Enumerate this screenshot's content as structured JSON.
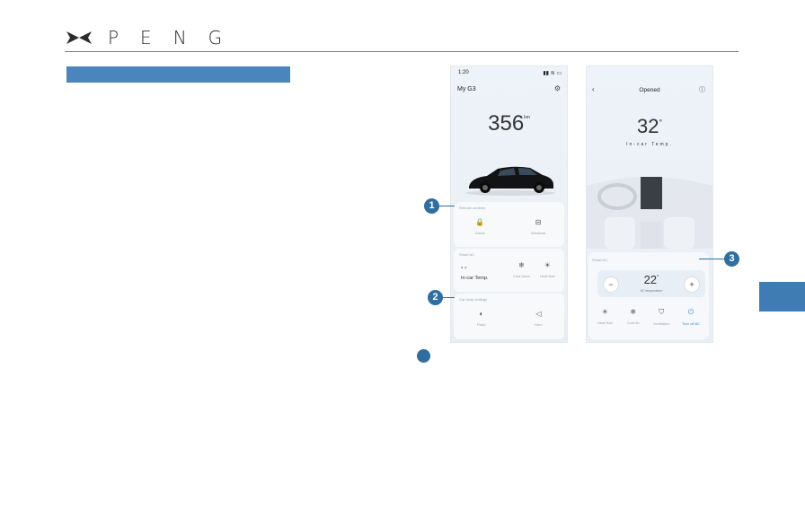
{
  "brand": {
    "name": "PENG"
  },
  "phone1": {
    "status_time": "1:20",
    "status_icons": "▮▮ ≋ ▭",
    "title": "My G3",
    "range_value": "356",
    "range_unit": "km",
    "remote_card": {
      "label": "Remote controls",
      "controls": [
        {
          "icon": "🔒",
          "label": "Doors"
        },
        {
          "icon": "⊟",
          "label": "Windows"
        }
      ]
    },
    "ac_card": {
      "label": "Smart AC",
      "dash": "- -",
      "temp_label": "In-car Temp.",
      "controls": [
        {
          "icon": "❄",
          "label": "Cool down"
        },
        {
          "icon": "☀",
          "label": "Heat flow"
        }
      ]
    },
    "lights_card": {
      "label": "Car lamp settings",
      "controls": [
        {
          "icon": "◐",
          "label": "Flash"
        },
        {
          "icon": "◁",
          "label": "Horn"
        }
      ]
    }
  },
  "phone2": {
    "title": "Opened",
    "temp_value": "32",
    "temp_degree": "°",
    "temp_caption": "In-car Temp.",
    "panel_label": "Smart AC",
    "minus": "−",
    "plus": "+",
    "set_temp": "22",
    "set_degree": "°",
    "set_caption": "AC temperature",
    "buttons": [
      {
        "icon": "☀",
        "label": "Heat flow"
      },
      {
        "icon": "❄",
        "label": "Cool flo"
      },
      {
        "icon": "⛉",
        "label": "Ventilation"
      },
      {
        "icon": "⏻",
        "label": "Turn off AC"
      }
    ]
  },
  "callouts": [
    "1",
    "2",
    "3"
  ],
  "colors": {
    "accent": "#4a86bd",
    "callout": "#2f6e9e",
    "highlight": "#3a86c8"
  }
}
